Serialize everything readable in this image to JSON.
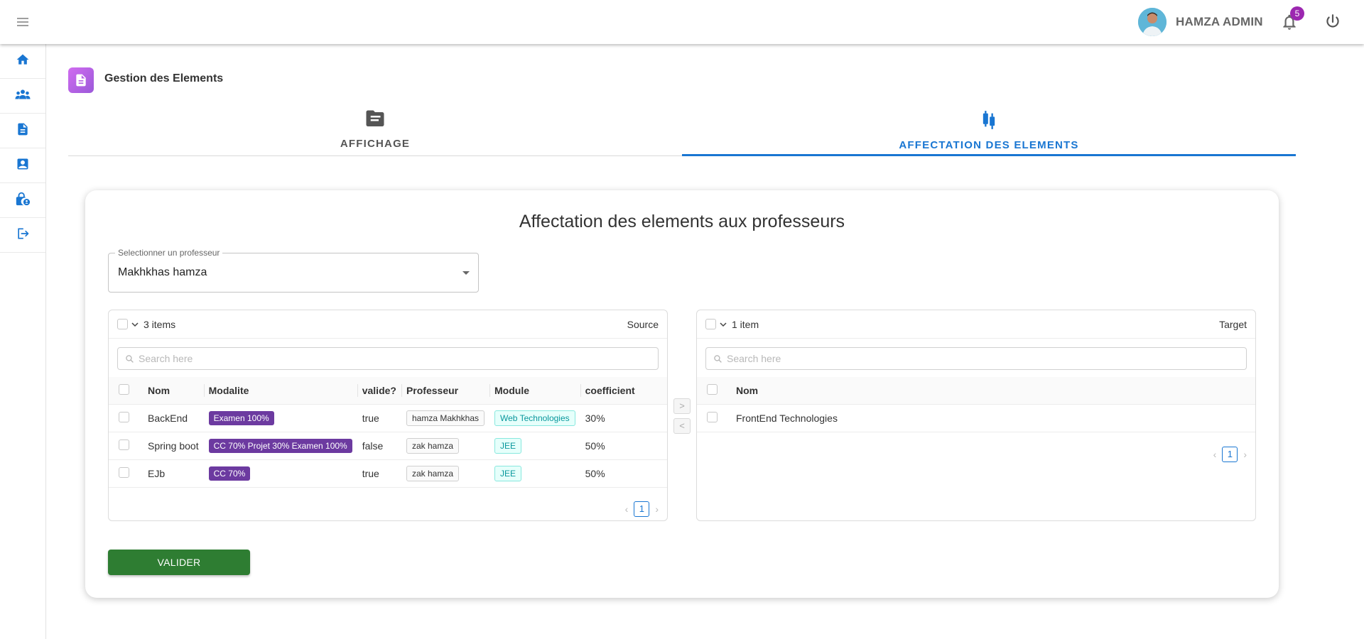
{
  "header": {
    "user_name": "HAMZA ADMIN",
    "notification_count": "5"
  },
  "sidebar": {
    "items": [
      {
        "icon": "home-icon"
      },
      {
        "icon": "users-icon"
      },
      {
        "icon": "document-icon"
      },
      {
        "icon": "profile-card-icon"
      },
      {
        "icon": "lock-user-icon"
      },
      {
        "icon": "logout-icon"
      }
    ]
  },
  "page": {
    "title": "Gestion des Elements"
  },
  "tabs": [
    {
      "label": "AFFICHAGE",
      "icon": "folder-icon",
      "active": false
    },
    {
      "label": "AFFECTATION DES ELEMENTS",
      "icon": "candlestick-icon",
      "active": true
    }
  ],
  "card": {
    "title": "Affectation des elements aux professeurs"
  },
  "select_professor": {
    "label": "Selectionner un professeur",
    "value": "Makhkhas hamza"
  },
  "source": {
    "count": "3 items",
    "title": "Source",
    "search_placeholder": "Search here",
    "columns": [
      "Nom",
      "Modalite",
      "valide?",
      "Professeur",
      "Module",
      "coefficient"
    ],
    "rows": [
      {
        "nom": "BackEnd",
        "modalite": "Examen 100%",
        "valide": "true",
        "professeur": "hamza Makhkhas",
        "module": "Web Technologies",
        "coefficient": "30%"
      },
      {
        "nom": "Spring boot",
        "modalite": "CC 70% Projet 30% Examen 100%",
        "valide": "false",
        "professeur": "zak hamza",
        "module": "JEE",
        "coefficient": "50%"
      },
      {
        "nom": "EJb",
        "modalite": "CC 70%",
        "valide": "true",
        "professeur": "zak hamza",
        "module": "JEE",
        "coefficient": "50%"
      }
    ],
    "page": "1"
  },
  "target": {
    "count": "1 item",
    "title": "Target",
    "search_placeholder": "Search here",
    "columns": [
      "Nom"
    ],
    "rows": [
      {
        "nom": "FrontEnd Technologies"
      }
    ],
    "page": "1"
  },
  "transfer": {
    "to_target": ">",
    "to_source": "<"
  },
  "actions": {
    "valider_label": "VALIDER"
  },
  "colors": {
    "accent": "#1976d2",
    "valider": "#2e7d32",
    "modalite_tag": "#6c3aa0",
    "badge": "#9c27b0"
  }
}
